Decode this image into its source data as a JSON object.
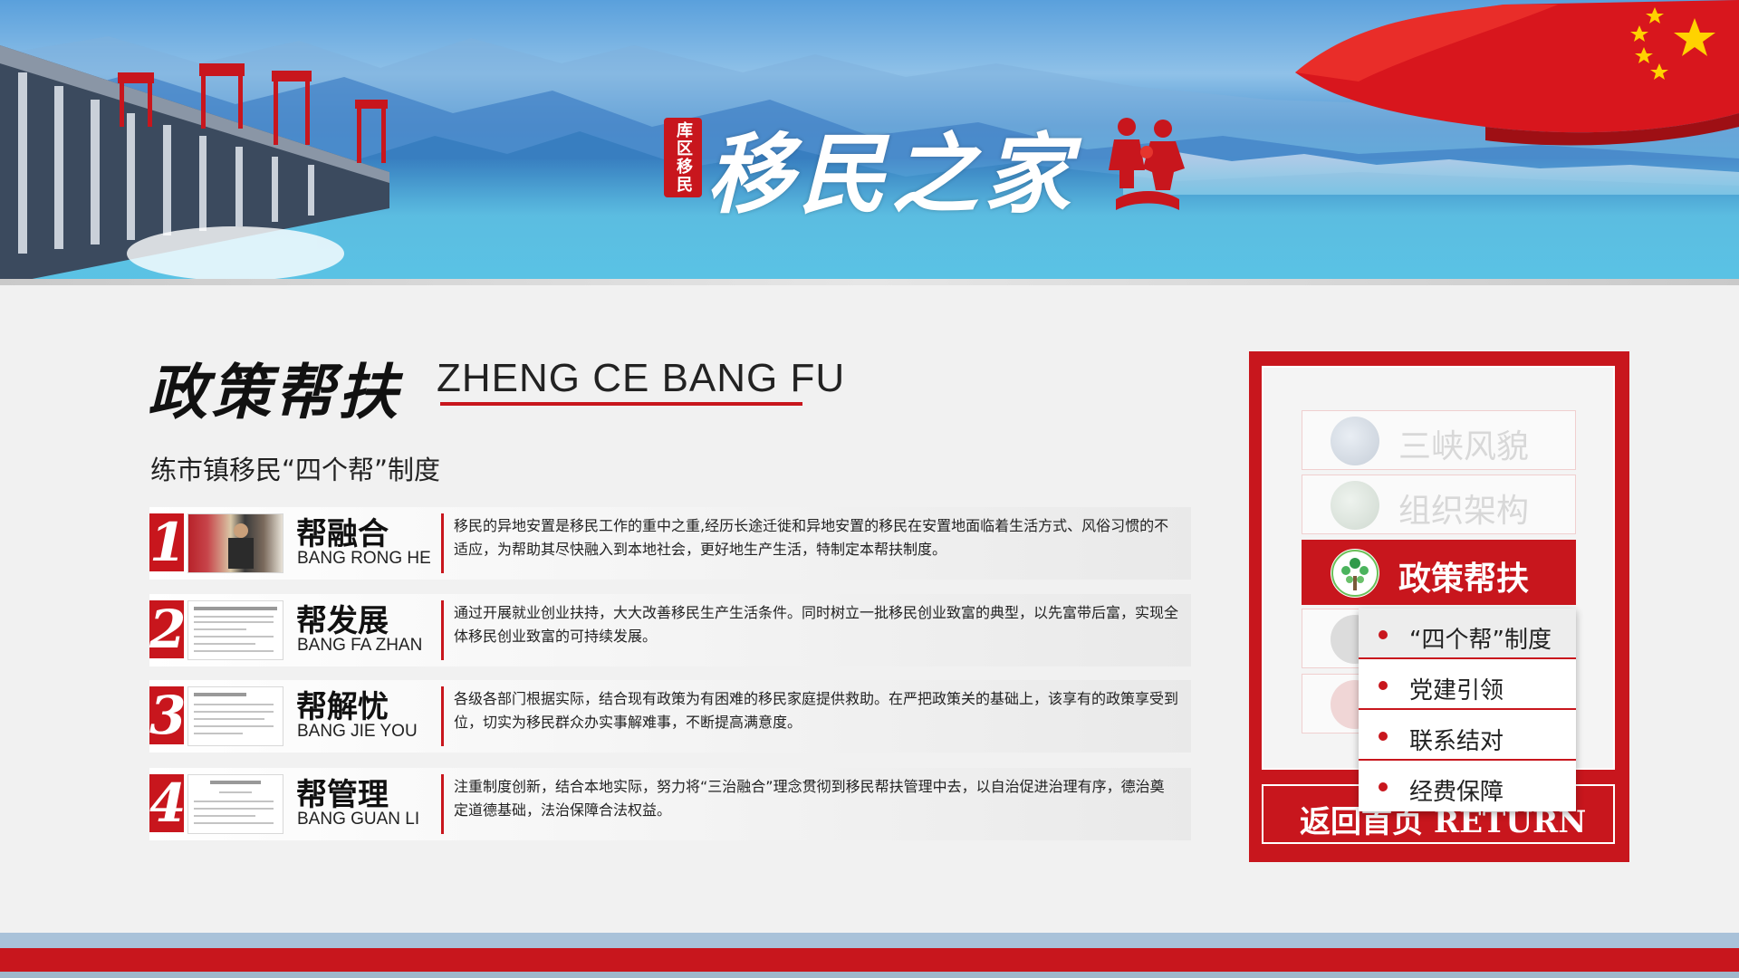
{
  "banner": {
    "title": "移民之家",
    "seal_text": "库区移民"
  },
  "section": {
    "title_cn": "政策帮扶",
    "title_en": "ZHENG CE BANG FU",
    "subtitle": "练市镇移民“四个帮”制度"
  },
  "rows": [
    {
      "num": "1",
      "label_cn": "帮融合",
      "label_en": "BANG RONG HE",
      "desc": "移民的异地安置是移民工作的重中之重,经历长途迁徙和异地安置的移民在安置地面临着生活方式、风俗习惯的不适应，为帮助其尽快融入到本地社会，更好地生产生活，特制定本帮扶制度。"
    },
    {
      "num": "2",
      "label_cn": "帮发展",
      "label_en": "BANG FA ZHAN",
      "desc": "通过开展就业创业扶持，大大改善移民生产生活条件。同时树立一批移民创业致富的典型，以先富带后富，实现全体移民创业致富的可持续发展。"
    },
    {
      "num": "3",
      "label_cn": "帮解忧",
      "label_en": "BANG JIE YOU",
      "desc": "各级各部门根据实际，结合现有政策为有困难的移民家庭提供救助。在严把政策关的基础上，该享有的政策享受到位，切实为移民群众办实事解难事，不断提高满意度。"
    },
    {
      "num": "4",
      "label_cn": "帮管理",
      "label_en": "BANG GUAN LI",
      "desc": "注重制度创新，结合本地实际，努力将“三治融合”理念贯彻到移民帮扶管理中去，以自治促进治理有序，德治奠定道德基础，法治保障合法权益。"
    }
  ],
  "nav": {
    "items": [
      {
        "label": "三峡风貌",
        "icon": "dam-icon"
      },
      {
        "label": "组织架构",
        "icon": "org-chart-icon"
      },
      {
        "label": "政策帮扶",
        "icon": "tree-icon"
      }
    ],
    "dropdown": [
      {
        "label": "“四个帮”制度"
      },
      {
        "label": "党建引领"
      },
      {
        "label": "联系结对"
      },
      {
        "label": "经费保障"
      }
    ],
    "return_label": "返回首页 RETURN"
  },
  "colors": {
    "accent_red": "#c8161d",
    "footer_blue": "#a9c2d9"
  }
}
